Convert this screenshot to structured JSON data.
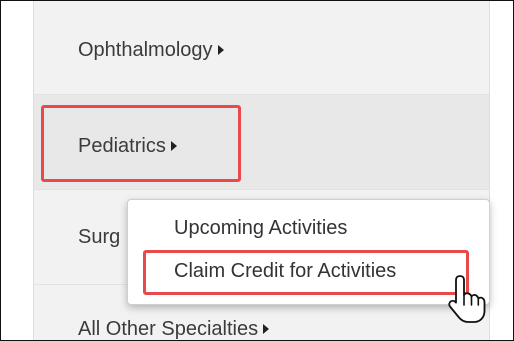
{
  "menu": {
    "items": [
      {
        "label": "Ophthalmology"
      },
      {
        "label": "Pediatrics"
      },
      {
        "label": "Surg"
      },
      {
        "label": "All Other Specialties"
      }
    ]
  },
  "dropdown": {
    "items": [
      {
        "label": "Upcoming Activities"
      },
      {
        "label": "Claim Credit for Activities"
      }
    ]
  },
  "colors": {
    "highlight": "#e8494b",
    "panel_bg": "#f2f2f2",
    "hover_bg": "#e8e8e8",
    "text": "#3b3b3b"
  },
  "icons": [
    "caret-right-icon",
    "hand-pointer-cursor-icon"
  ]
}
